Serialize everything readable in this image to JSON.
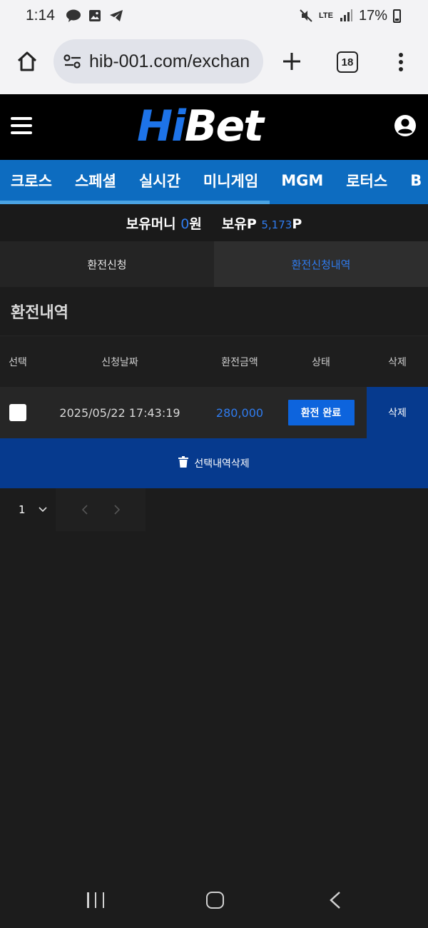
{
  "status_bar": {
    "time": "1:14",
    "network": "LTE",
    "battery": "17%"
  },
  "browser": {
    "url": "hib-001.com/exchan",
    "tab_count": "18"
  },
  "site": {
    "logo_part1": "Hi",
    "logo_part2": "Bet",
    "categories": [
      "크로스",
      "스페셜",
      "실시간",
      "미니게임",
      "MGM",
      "로터스",
      "B"
    ]
  },
  "balance": {
    "money_label": "보유머니",
    "money_value": "0",
    "money_unit": "원",
    "point_label": "보유P",
    "point_value": "5,173",
    "point_unit": "P"
  },
  "tabs": {
    "request": "환전신청",
    "history": "환전신청내역"
  },
  "section": {
    "title": "환전내역"
  },
  "table": {
    "headers": [
      "선택",
      "신청날짜",
      "환전금액",
      "상태",
      "삭제"
    ],
    "rows": [
      {
        "date": "2025/05/22 17:43:19",
        "amount": "280,000",
        "status": "환전 완료",
        "delete": "삭제"
      }
    ]
  },
  "actions": {
    "bulk_delete": "선택내역삭제"
  },
  "pagination": {
    "page": "1"
  },
  "colors": {
    "accent_blue": "#2f7cf0",
    "nav_blue": "#0d6cc0",
    "delete_navy": "#063a8e"
  }
}
